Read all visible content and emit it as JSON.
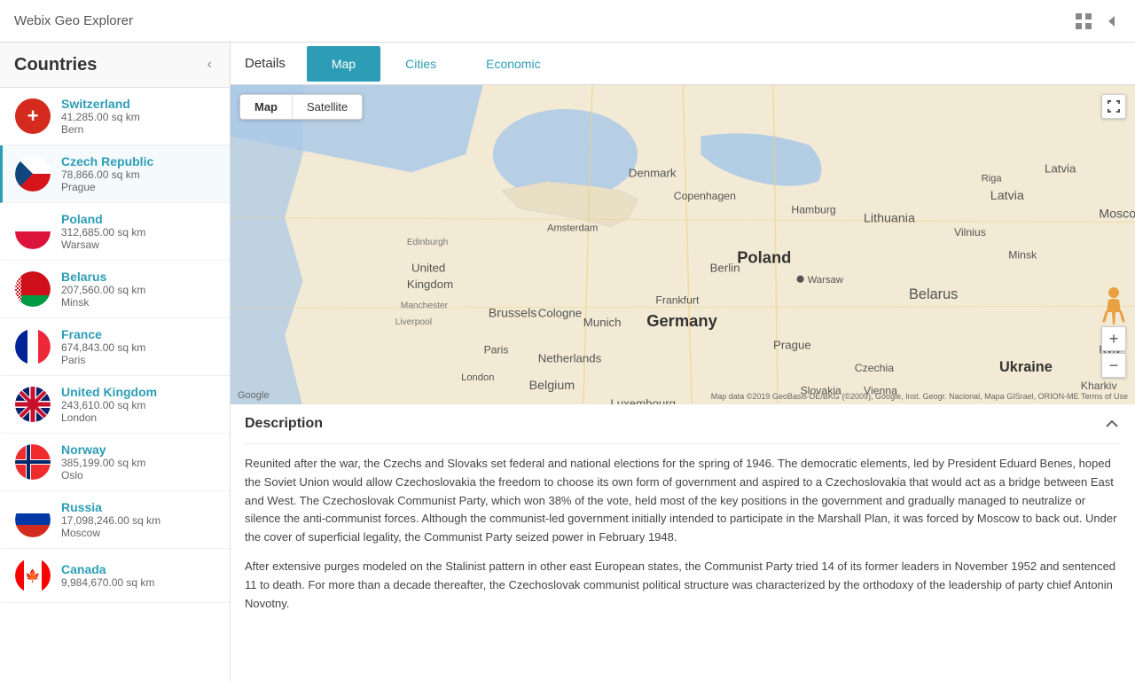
{
  "app": {
    "title": "Webix Geo Explorer"
  },
  "topbar": {
    "icons": [
      "grid-icon",
      "arrow-left-icon"
    ]
  },
  "sidebar": {
    "title": "Countries",
    "collapse_label": "‹",
    "countries": [
      {
        "name": "Switzerland",
        "area": "41,285.00 sq km",
        "capital": "Bern",
        "flag_code": "ch"
      },
      {
        "name": "Czech Republic",
        "area": "78,866.00 sq km",
        "capital": "Prague",
        "flag_code": "cz",
        "active": true
      },
      {
        "name": "Poland",
        "area": "312,685.00 sq km",
        "capital": "Warsaw",
        "flag_code": "pl"
      },
      {
        "name": "Belarus",
        "area": "207,560.00 sq km",
        "capital": "Minsk",
        "flag_code": "by"
      },
      {
        "name": "France",
        "area": "674,843.00 sq km",
        "capital": "Paris",
        "flag_code": "fr"
      },
      {
        "name": "United Kingdom",
        "area": "243,610.00 sq km",
        "capital": "London",
        "flag_code": "gb"
      },
      {
        "name": "Norway",
        "area": "385,199.00 sq km",
        "capital": "Oslo",
        "flag_code": "no"
      },
      {
        "name": "Russia",
        "area": "17,098,246.00 sq km",
        "capital": "Moscow",
        "flag_code": "ru"
      },
      {
        "name": "Canada",
        "area": "9,984,670.00 sq km",
        "capital": "",
        "flag_code": "ca"
      }
    ]
  },
  "tabs": {
    "details_label": "Details",
    "map_label": "Map",
    "cities_label": "Cities",
    "economic_label": "Economic"
  },
  "map": {
    "toggle_map": "Map",
    "toggle_satellite": "Satellite",
    "watermark": "Google",
    "copyright": "Map data ©2019 GeoBasis-DE/BKG (©2009), Google, Inst. Geogr. Nacional, Mapa GISrael, ORION-ME   Terms of Use"
  },
  "description": {
    "title": "Description",
    "collapse_icon": "^",
    "paragraphs": [
      "Reunited after the war, the Czechs and Slovaks set federal and national elections for the spring of 1946. The democratic elements, led by President Eduard Benes, hoped the Soviet Union would allow Czechoslovakia the freedom to choose its own form of government and aspired to a Czechoslovakia that would act as a bridge between East and West. The Czechoslovak Communist Party, which won 38% of the vote, held most of the key positions in the government and gradually managed to neutralize or silence the anti-communist forces. Although the communist-led government initially intended to participate in the Marshall Plan, it was forced by Moscow to back out. Under the cover of superficial legality, the Communist Party seized power in February 1948.",
      "After extensive purges modeled on the Stalinist pattern in other east European states, the Communist Party tried 14 of its former leaders in November 1952 and sentenced 11 to death. For more than a decade thereafter, the Czechoslovak communist political structure was characterized by the orthodoxy of the leadership of party chief Antonin Novotny."
    ]
  }
}
